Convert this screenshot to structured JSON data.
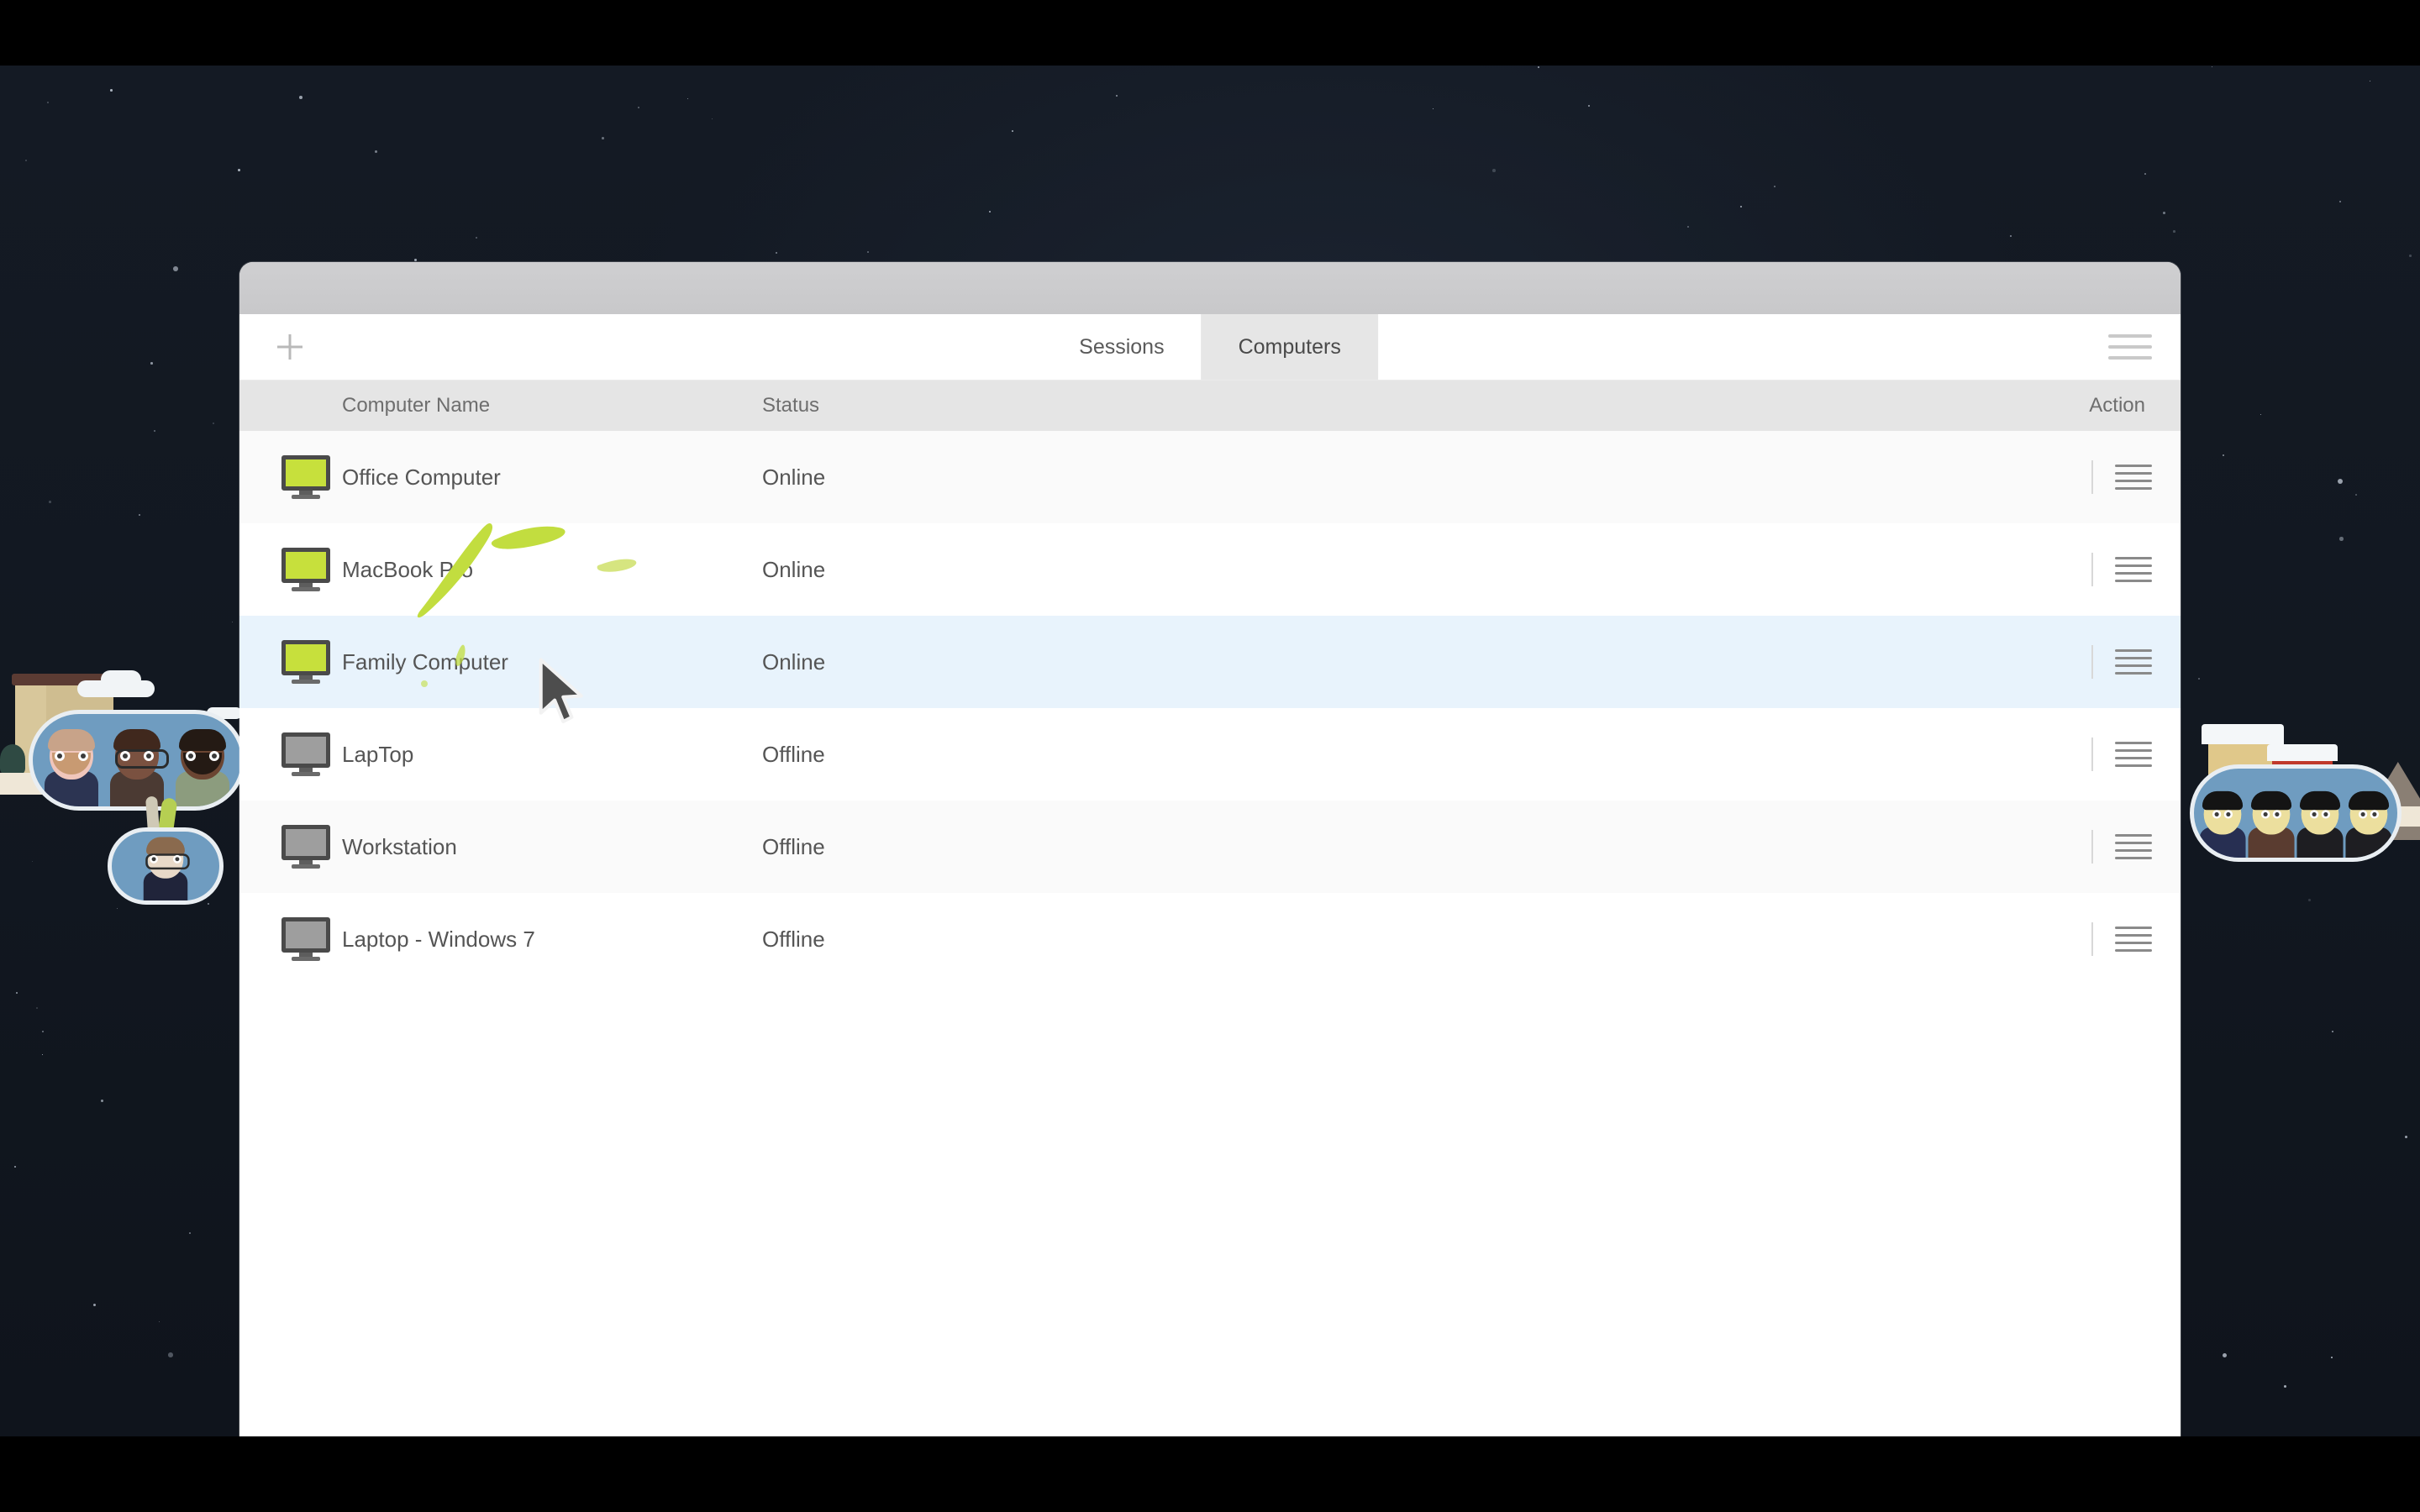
{
  "window": {
    "titlebar_color": "#c8c8ca",
    "background_color": "#ffffff"
  },
  "toolbar": {
    "add_label": "+",
    "add_icon": "plus-icon",
    "menu_icon": "hamburger-menu-icon",
    "tabs": [
      {
        "label": "Sessions",
        "active": false
      },
      {
        "label": "Computers",
        "active": true
      }
    ]
  },
  "table": {
    "columns": [
      "Computer Name",
      "Status",
      "Action"
    ],
    "column_icon_header": "",
    "rows": [
      {
        "name": "Office Computer",
        "status": "Online",
        "icon": "monitor-online-icon",
        "selected": false
      },
      {
        "name": "MacBook Pro",
        "status": "Online",
        "icon": "monitor-online-icon",
        "selected": false
      },
      {
        "name": "Family Computer",
        "status": "Online",
        "icon": "monitor-online-icon",
        "selected": true
      },
      {
        "name": "LapTop",
        "status": "Offline",
        "icon": "monitor-offline-icon",
        "selected": false
      },
      {
        "name": "Workstation",
        "status": "Offline",
        "icon": "monitor-offline-icon",
        "selected": false
      },
      {
        "name": "Laptop - Windows 7",
        "status": "Offline",
        "icon": "monitor-offline-icon",
        "selected": false
      }
    ],
    "row_action_icon": "row-menu-icon"
  },
  "colors": {
    "online_screen": "#c7e03c",
    "offline_screen": "#9e9e9e",
    "selected_row": "#e8f3fc",
    "header_row": "#e5e5e5",
    "brush_stroke": "#c2dd3f",
    "backdrop_sky": "#121821",
    "letterbox": "#000000"
  },
  "decoration": {
    "left_scene": "night-city-illustration",
    "right_scene": "snow-village-illustration",
    "brush_annotation": "green-highlight-stroke",
    "cursor": "arrow-cursor"
  }
}
